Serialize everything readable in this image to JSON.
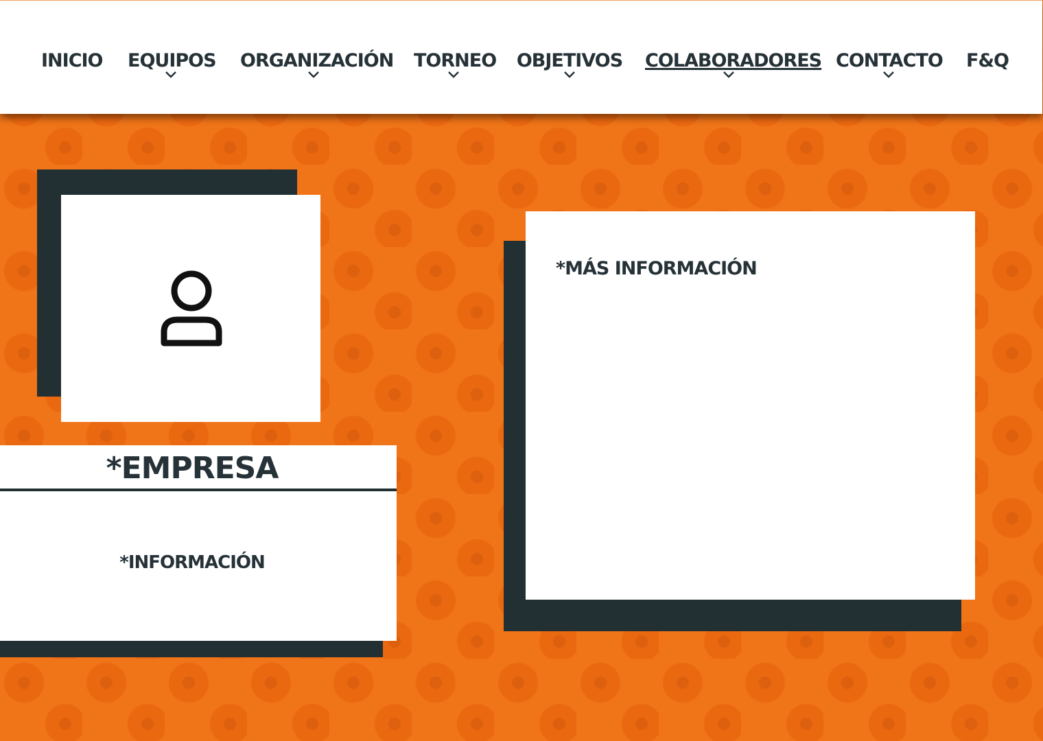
{
  "nav": {
    "items": [
      {
        "label": "INICIO"
      },
      {
        "label": "EQUIPOS"
      },
      {
        "label": "ORGANIZACIÓN"
      },
      {
        "label": "TORNEO"
      },
      {
        "label": "OBJETIVOS"
      },
      {
        "label": "COLABORADORES"
      },
      {
        "label": "CONTACTO"
      },
      {
        "label": "F&Q"
      }
    ],
    "active": "COLABORADORES"
  },
  "profile": {
    "icon": "user-icon"
  },
  "company": {
    "name": "*EMPRESA",
    "info": "*INFORMACIÓN"
  },
  "details": {
    "more_info": "*MÁS INFORMACIÓN"
  },
  "colors": {
    "background": "#f07418",
    "dark": "#223033",
    "text": "#263238",
    "white": "#ffffff"
  }
}
